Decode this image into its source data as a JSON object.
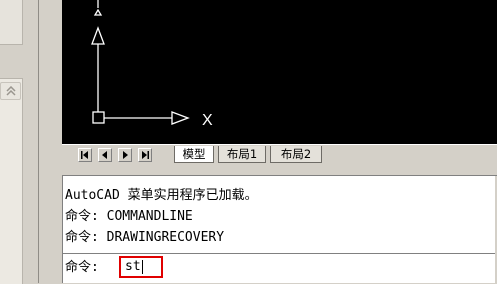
{
  "tabs": {
    "nav": [
      "first",
      "prev",
      "next",
      "last"
    ],
    "items": [
      {
        "label": "模型",
        "active": true
      },
      {
        "label": "布局1",
        "active": false
      },
      {
        "label": "布局2",
        "active": false
      }
    ]
  },
  "ucs": {
    "x_label": "X"
  },
  "command": {
    "history": [
      "AutoCAD 菜单实用程序已加载。",
      "命令: COMMANDLINE",
      "命令: DRAWINGRECOVERY"
    ],
    "prompt": "命令:",
    "input_value": "st"
  },
  "colors": {
    "canvas_bg": "#000000",
    "ucs_stroke": "#ffffff",
    "highlight": "#e00000",
    "chrome": "#d4d0c8"
  }
}
